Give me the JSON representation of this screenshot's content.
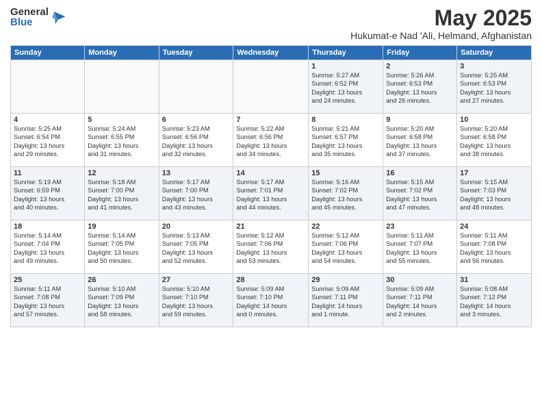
{
  "logo": {
    "general": "General",
    "blue": "Blue"
  },
  "title": "May 2025",
  "location": "Hukumat-e Nad 'Ali, Helmand, Afghanistan",
  "headers": [
    "Sunday",
    "Monday",
    "Tuesday",
    "Wednesday",
    "Thursday",
    "Friday",
    "Saturday"
  ],
  "weeks": [
    [
      {
        "day": "",
        "info": ""
      },
      {
        "day": "",
        "info": ""
      },
      {
        "day": "",
        "info": ""
      },
      {
        "day": "",
        "info": ""
      },
      {
        "day": "1",
        "info": "Sunrise: 5:27 AM\nSunset: 6:52 PM\nDaylight: 13 hours\nand 24 minutes."
      },
      {
        "day": "2",
        "info": "Sunrise: 5:26 AM\nSunset: 6:53 PM\nDaylight: 13 hours\nand 26 minutes."
      },
      {
        "day": "3",
        "info": "Sunrise: 5:25 AM\nSunset: 6:53 PM\nDaylight: 13 hours\nand 27 minutes."
      }
    ],
    [
      {
        "day": "4",
        "info": "Sunrise: 5:25 AM\nSunset: 6:54 PM\nDaylight: 13 hours\nand 29 minutes."
      },
      {
        "day": "5",
        "info": "Sunrise: 5:24 AM\nSunset: 6:55 PM\nDaylight: 13 hours\nand 31 minutes."
      },
      {
        "day": "6",
        "info": "Sunrise: 5:23 AM\nSunset: 6:56 PM\nDaylight: 13 hours\nand 32 minutes."
      },
      {
        "day": "7",
        "info": "Sunrise: 5:22 AM\nSunset: 6:56 PM\nDaylight: 13 hours\nand 34 minutes."
      },
      {
        "day": "8",
        "info": "Sunrise: 5:21 AM\nSunset: 6:57 PM\nDaylight: 13 hours\nand 35 minutes."
      },
      {
        "day": "9",
        "info": "Sunrise: 5:20 AM\nSunset: 6:58 PM\nDaylight: 13 hours\nand 37 minutes."
      },
      {
        "day": "10",
        "info": "Sunrise: 5:20 AM\nSunset: 6:58 PM\nDaylight: 13 hours\nand 38 minutes."
      }
    ],
    [
      {
        "day": "11",
        "info": "Sunrise: 5:19 AM\nSunset: 6:59 PM\nDaylight: 13 hours\nand 40 minutes."
      },
      {
        "day": "12",
        "info": "Sunrise: 5:18 AM\nSunset: 7:00 PM\nDaylight: 13 hours\nand 41 minutes."
      },
      {
        "day": "13",
        "info": "Sunrise: 5:17 AM\nSunset: 7:00 PM\nDaylight: 13 hours\nand 43 minutes."
      },
      {
        "day": "14",
        "info": "Sunrise: 5:17 AM\nSunset: 7:01 PM\nDaylight: 13 hours\nand 44 minutes."
      },
      {
        "day": "15",
        "info": "Sunrise: 5:16 AM\nSunset: 7:02 PM\nDaylight: 13 hours\nand 45 minutes."
      },
      {
        "day": "16",
        "info": "Sunrise: 5:15 AM\nSunset: 7:02 PM\nDaylight: 13 hours\nand 47 minutes."
      },
      {
        "day": "17",
        "info": "Sunrise: 5:15 AM\nSunset: 7:03 PM\nDaylight: 13 hours\nand 48 minutes."
      }
    ],
    [
      {
        "day": "18",
        "info": "Sunrise: 5:14 AM\nSunset: 7:04 PM\nDaylight: 13 hours\nand 49 minutes."
      },
      {
        "day": "19",
        "info": "Sunrise: 5:14 AM\nSunset: 7:05 PM\nDaylight: 13 hours\nand 50 minutes."
      },
      {
        "day": "20",
        "info": "Sunrise: 5:13 AM\nSunset: 7:05 PM\nDaylight: 13 hours\nand 52 minutes."
      },
      {
        "day": "21",
        "info": "Sunrise: 5:12 AM\nSunset: 7:06 PM\nDaylight: 13 hours\nand 53 minutes."
      },
      {
        "day": "22",
        "info": "Sunrise: 5:12 AM\nSunset: 7:06 PM\nDaylight: 13 hours\nand 54 minutes."
      },
      {
        "day": "23",
        "info": "Sunrise: 5:11 AM\nSunset: 7:07 PM\nDaylight: 13 hours\nand 55 minutes."
      },
      {
        "day": "24",
        "info": "Sunrise: 5:11 AM\nSunset: 7:08 PM\nDaylight: 13 hours\nand 56 minutes."
      }
    ],
    [
      {
        "day": "25",
        "info": "Sunrise: 5:11 AM\nSunset: 7:08 PM\nDaylight: 13 hours\nand 57 minutes."
      },
      {
        "day": "26",
        "info": "Sunrise: 5:10 AM\nSunset: 7:09 PM\nDaylight: 13 hours\nand 58 minutes."
      },
      {
        "day": "27",
        "info": "Sunrise: 5:10 AM\nSunset: 7:10 PM\nDaylight: 13 hours\nand 59 minutes."
      },
      {
        "day": "28",
        "info": "Sunrise: 5:09 AM\nSunset: 7:10 PM\nDaylight: 14 hours\nand 0 minutes."
      },
      {
        "day": "29",
        "info": "Sunrise: 5:09 AM\nSunset: 7:11 PM\nDaylight: 14 hours\nand 1 minute."
      },
      {
        "day": "30",
        "info": "Sunrise: 5:09 AM\nSunset: 7:11 PM\nDaylight: 14 hours\nand 2 minutes."
      },
      {
        "day": "31",
        "info": "Sunrise: 5:08 AM\nSunset: 7:12 PM\nDaylight: 14 hours\nand 3 minutes."
      }
    ]
  ]
}
